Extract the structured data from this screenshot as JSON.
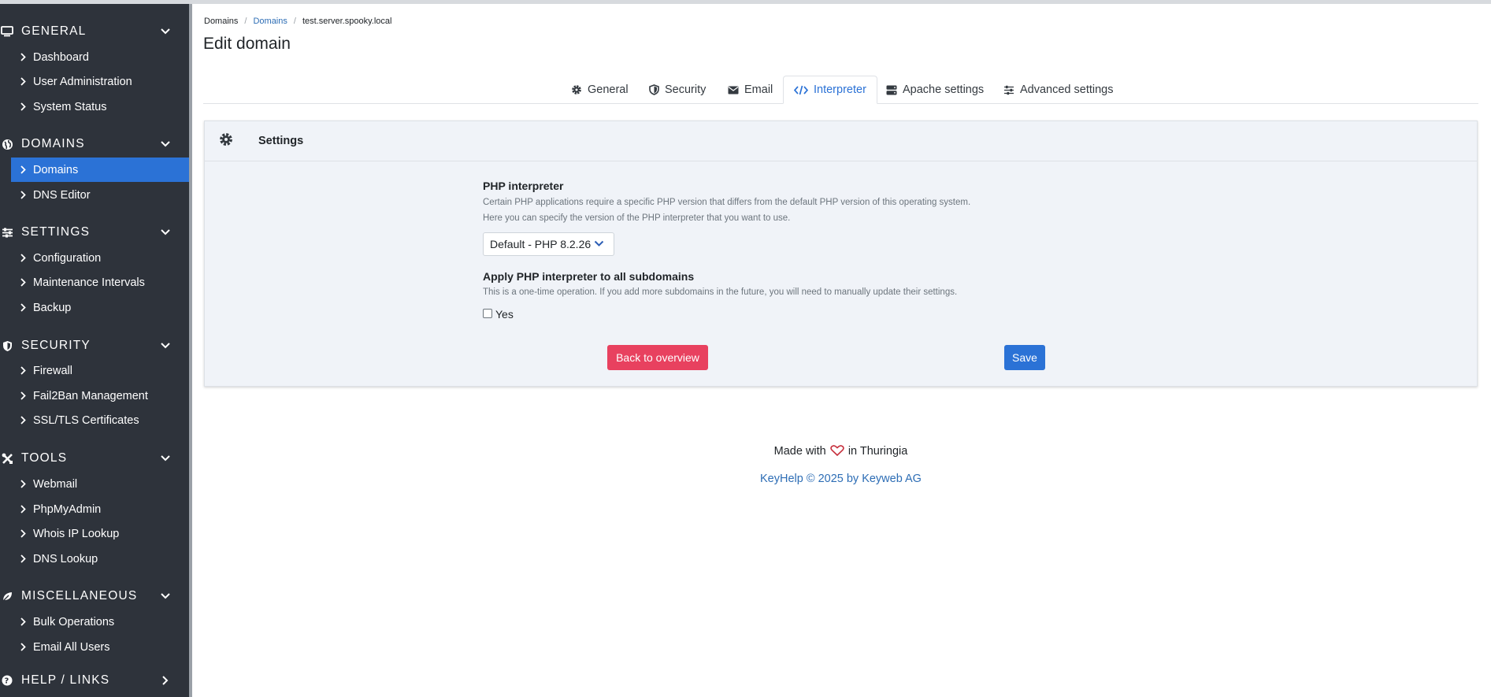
{
  "sidebar": {
    "sections": [
      {
        "title": "GENERAL",
        "icon": "monitor-icon",
        "items": [
          "Dashboard",
          "User Administration",
          "System Status"
        ]
      },
      {
        "title": "DOMAINS",
        "icon": "globe-icon",
        "items": [
          "Domains",
          "DNS Editor"
        ]
      },
      {
        "title": "SETTINGS",
        "icon": "sliders-icon",
        "items": [
          "Configuration",
          "Maintenance Intervals",
          "Backup"
        ]
      },
      {
        "title": "SECURITY",
        "icon": "shield-icon",
        "items": [
          "Firewall",
          "Fail2Ban Management",
          "SSL/TLS Certificates"
        ]
      },
      {
        "title": "TOOLS",
        "icon": "tools-icon",
        "items": [
          "Webmail",
          "PhpMyAdmin",
          "Whois IP Lookup",
          "DNS Lookup"
        ]
      },
      {
        "title": "MISCELLANEOUS",
        "icon": "leaf-icon",
        "items": [
          "Bulk Operations",
          "Email All Users"
        ]
      },
      {
        "title": "HELP / LINKS",
        "icon": "question-icon",
        "items": []
      }
    ],
    "active_item": "Domains"
  },
  "breadcrumb": [
    "Domains",
    "Domains",
    "test.server.spooky.local"
  ],
  "page_title": "Edit domain",
  "tabs": [
    {
      "label": "General",
      "icon": "gear-icon"
    },
    {
      "label": "Security",
      "icon": "shield-icon"
    },
    {
      "label": "Email",
      "icon": "envelope-icon"
    },
    {
      "label": "Interpreter",
      "icon": "code-icon",
      "active": true
    },
    {
      "label": "Apache settings",
      "icon": "server-icon"
    },
    {
      "label": "Advanced settings",
      "icon": "sliders-icon"
    }
  ],
  "card": {
    "title": "Settings",
    "php_label": "PHP interpreter",
    "php_help_1": "Certain PHP applications require a specific PHP version that differs from the default PHP version of this operating system.",
    "php_help_2": "Here you can specify the version of the PHP interpreter that you want to use.",
    "php_selected": "Default - PHP 8.2.26",
    "apply_label": "Apply PHP interpreter to all subdomains",
    "apply_help": "This is a one-time operation. If you add more subdomains in the future, you will need to manually update their settings.",
    "apply_checked": false,
    "checkbox_label": "Yes",
    "back_button": "Back to overview",
    "save_button": "Save"
  },
  "footer": {
    "made_with": "Made with",
    "in_place": "in Thuringia",
    "copyright": "KeyHelp © 2025 by Keyweb AG"
  },
  "colors": {
    "sidebar_bg": "#2e333b",
    "accent": "#2b72d6",
    "danger": "#e8415f",
    "card_bg": "#f0f3f8"
  }
}
